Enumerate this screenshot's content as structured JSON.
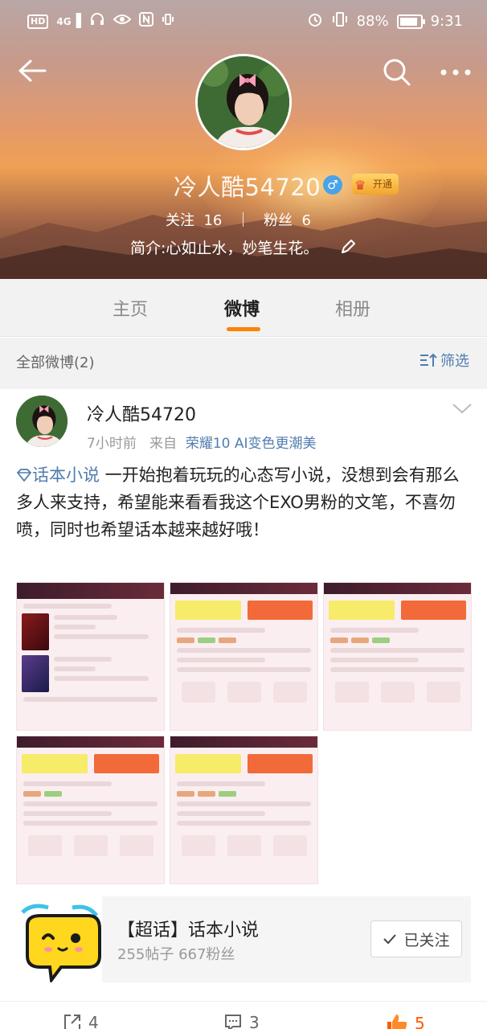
{
  "status_bar": {
    "left_icons": [
      "hd-icon",
      "signal-4g-icon",
      "headset-icon",
      "eye-icon",
      "nfc-icon",
      "vibrate-icon"
    ],
    "network": "4G",
    "hd_label": "HD",
    "battery_percent": "88%",
    "battery_level": 0.88,
    "time": "9:31"
  },
  "profile": {
    "name": "冷人酷54720",
    "gender": "♂",
    "vip_label": "开通",
    "following_label": "关注",
    "following_count": "16",
    "followers_label": "粉丝",
    "followers_count": "6",
    "bio": "简介:心如止水，妙笔生花。"
  },
  "tabs": [
    {
      "label": "主页"
    },
    {
      "label": "微博",
      "active": true
    },
    {
      "label": "相册"
    }
  ],
  "filter": {
    "title": "全部微博(2)",
    "button_label": "筛选"
  },
  "post": {
    "author": "冷人酷54720",
    "time": "7小时前",
    "source_prefix": "来自",
    "source": "荣耀10 AI变色更潮美",
    "topic": "话本小说",
    "text": " 一开始抱着玩玩的心态写小说，没想到会有那么多人来支持，希望能来看看我这个EXO男粉的文笔，不喜勿喷，同时也希望话本越来越好哦！"
  },
  "topic_card": {
    "title": "【超话】话本小说",
    "stats": "255帖子 667粉丝",
    "button_label": "已关注"
  },
  "actions": {
    "share_count": "4",
    "comment_count": "3",
    "like_count": "5"
  },
  "colors": {
    "accent_orange": "#ff8200",
    "link_blue": "#507daf",
    "like_orange": "#ff5a00"
  }
}
